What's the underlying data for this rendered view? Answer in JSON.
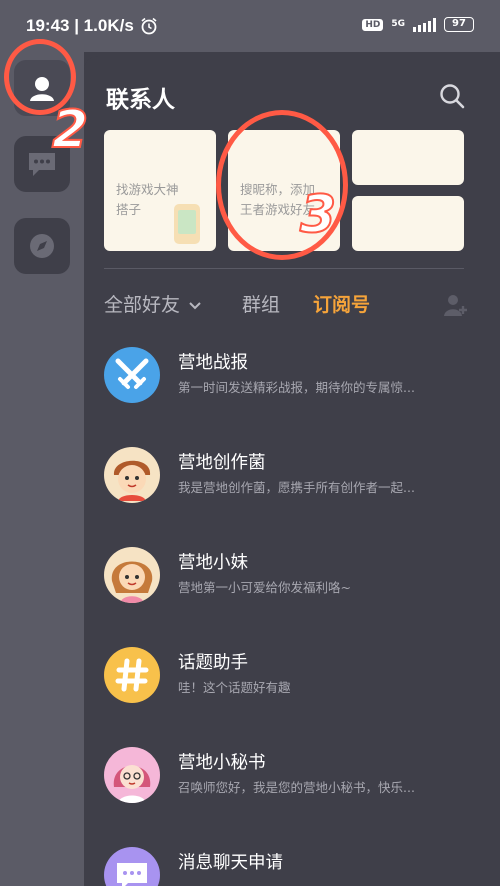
{
  "status_bar": {
    "time": "19:43 | 1.0K/s",
    "hd": "HD",
    "network": "5G",
    "battery": "97"
  },
  "panel": {
    "title": "联系人",
    "cards": [
      {
        "text": "找游戏大神\n搭子"
      },
      {
        "text": "搜昵称，添加\n王者游戏好友"
      },
      {
        "text": ""
      },
      {
        "text": ""
      }
    ]
  },
  "tabs": {
    "all_friends": "全部好友",
    "groups": "群组",
    "subscriptions": "订阅号"
  },
  "list": [
    {
      "title": "营地战报",
      "subtitle": "第一时间发送精彩战报，期待你的专属惊..."
    },
    {
      "title": "营地创作菌",
      "subtitle": "我是营地创作菌，愿携手所有创作者一起..."
    },
    {
      "title": "营地小妹",
      "subtitle": "营地第一小可爱给你发福利咯~"
    },
    {
      "title": "话题助手",
      "subtitle": "哇！这个话题好有趣"
    },
    {
      "title": "营地小秘书",
      "subtitle": "召唤师您好，我是您的营地小秘书，快乐..."
    },
    {
      "title": "消息聊天申请",
      "subtitle": ""
    }
  ],
  "annotations": [
    "2",
    "3"
  ],
  "colors": {
    "accent": "#f6a43a",
    "annotation": "#ff5a45",
    "background": "#3f3f49"
  }
}
